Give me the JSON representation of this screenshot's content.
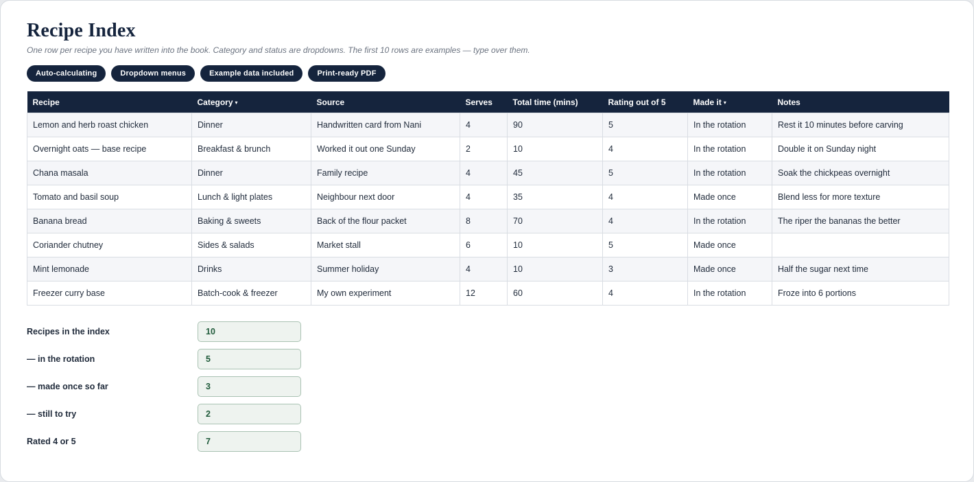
{
  "title": "Recipe Index",
  "subtitle": "One row per recipe you have written into the book. Category and status are dropdowns. The first 10 rows are examples — type over them.",
  "pills": [
    "Auto-calculating",
    "Dropdown menus",
    "Example data included",
    "Print-ready PDF"
  ],
  "table": {
    "headers": {
      "recipe": "Recipe",
      "category": "Category",
      "source": "Source",
      "serves": "Serves",
      "total_time": "Total time (mins)",
      "rating": "Rating out of 5",
      "made_it": "Made it",
      "notes": "Notes"
    },
    "dropdown_caret": "▾",
    "rows": [
      [
        "Lemon and herb roast chicken",
        "Dinner",
        "Handwritten card from Nani",
        "4",
        "90",
        "5",
        "In the rotation",
        "Rest it 10 minutes before carving"
      ],
      [
        "Overnight oats — base recipe",
        "Breakfast & brunch",
        "Worked it out one Sunday",
        "2",
        "10",
        "4",
        "In the rotation",
        "Double it on Sunday night"
      ],
      [
        "Chana masala",
        "Dinner",
        "Family recipe",
        "4",
        "45",
        "5",
        "In the rotation",
        "Soak the chickpeas overnight"
      ],
      [
        "Tomato and basil soup",
        "Lunch & light plates",
        "Neighbour next door",
        "4",
        "35",
        "4",
        "Made once",
        "Blend less for more texture"
      ],
      [
        "Banana bread",
        "Baking & sweets",
        "Back of the flour packet",
        "8",
        "70",
        "4",
        "In the rotation",
        "The riper the bananas the better"
      ],
      [
        "Coriander chutney",
        "Sides & salads",
        "Market stall",
        "6",
        "10",
        "5",
        "Made once",
        ""
      ],
      [
        "Mint lemonade",
        "Drinks",
        "Summer holiday",
        "4",
        "10",
        "3",
        "Made once",
        "Half the sugar next time"
      ],
      [
        "Freezer curry base",
        "Batch-cook & freezer",
        "My own experiment",
        "12",
        "60",
        "4",
        "In the rotation",
        "Froze into 6 portions"
      ]
    ]
  },
  "summary": [
    {
      "label": "Recipes in the index",
      "value": "10"
    },
    {
      "label": "— in the rotation",
      "value": "5"
    },
    {
      "label": "— made once so far",
      "value": "3"
    },
    {
      "label": "— still to try",
      "value": "2"
    },
    {
      "label": "Rated 4 or 5",
      "value": "7"
    }
  ],
  "colors": {
    "header_navy": "#15243d",
    "summary_value_bg": "#eef3ef",
    "summary_value_text": "#1f5a3a"
  }
}
